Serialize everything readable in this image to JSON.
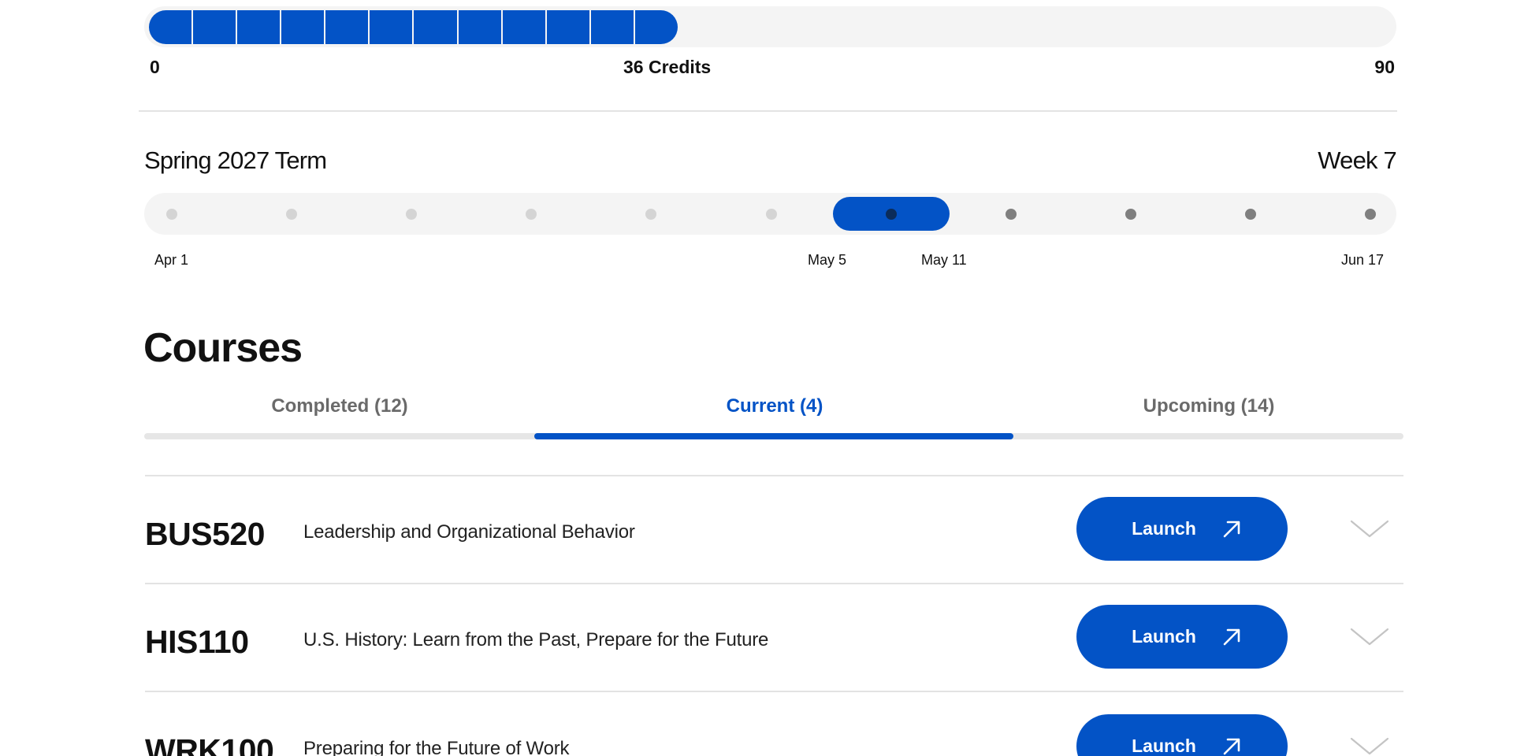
{
  "credits": {
    "earned": 36,
    "min_label": "0",
    "current_label": "36 Credits",
    "max_label": "90",
    "total": 90,
    "colors": {
      "fill": "#0353c6",
      "track": "#f4f4f4"
    }
  },
  "term": {
    "title": "Spring 2027 Term",
    "week_label": "Week 7",
    "total_weeks": 11,
    "current_week": 7,
    "dates": [
      {
        "label": "Apr 1"
      },
      {
        "label": "May 5"
      },
      {
        "label": "May 11"
      },
      {
        "label": "Jun 17"
      }
    ]
  },
  "courses": {
    "heading": "Courses",
    "tabs": [
      {
        "label": "Completed (12)",
        "active": false
      },
      {
        "label": "Current (4)",
        "active": true
      },
      {
        "label": "Upcoming (14)",
        "active": false
      }
    ],
    "items": [
      {
        "code": "BUS520",
        "name": "Leadership and Organizational Behavior",
        "action": "Launch"
      },
      {
        "code": "HIS110",
        "name": "U.S. History: Learn from the Past, Prepare for the Future",
        "action": "Launch"
      },
      {
        "code": "WRK100",
        "name": "Preparing for the Future of Work",
        "action": "Launch"
      }
    ]
  },
  "icons": {
    "launch": "arrow-up-right-icon",
    "expand": "chevron-down-icon"
  },
  "colors": {
    "accent": "#0353c6",
    "text": "#111111",
    "muted": "#6a6a6a",
    "divider": "#e3e3e3"
  }
}
